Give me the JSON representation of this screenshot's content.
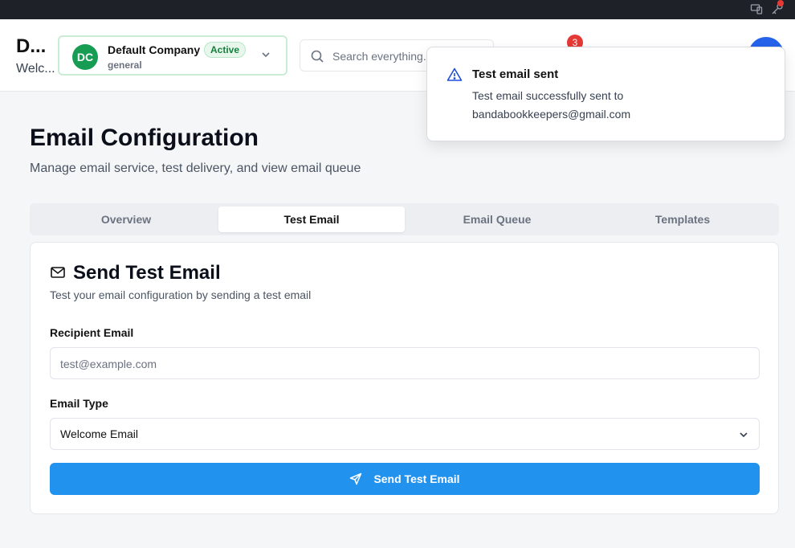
{
  "header": {
    "brand_title": "D...",
    "brand_subtitle": "Welc...",
    "company": {
      "initials": "DC",
      "name": "Default Company",
      "status": "Active",
      "subtitle": "general"
    },
    "search": {
      "placeholder": "Search everything..."
    },
    "notifications_count": "3"
  },
  "toast": {
    "icon": "warning-triangle-icon",
    "title": "Test email sent",
    "message": "Test email successfully sent to bandabookkeepers@gmail.com"
  },
  "page": {
    "title": "Email Configuration",
    "subtitle": "Manage email service, test delivery, and view email queue"
  },
  "tabs": [
    {
      "label": "Overview",
      "active": false
    },
    {
      "label": "Test Email",
      "active": true
    },
    {
      "label": "Email Queue",
      "active": false
    },
    {
      "label": "Templates",
      "active": false
    }
  ],
  "card": {
    "icon": "mail-icon",
    "title": "Send Test Email",
    "subtitle": "Test your email configuration by sending a test email",
    "recipient_label": "Recipient Email",
    "recipient_placeholder": "test@example.com",
    "recipient_value": "",
    "type_label": "Email Type",
    "type_value": "Welcome Email",
    "send_label": "Send Test Email"
  },
  "colors": {
    "primary": "#2193ef",
    "company_green": "#169c53",
    "badge_red": "#e53935"
  }
}
